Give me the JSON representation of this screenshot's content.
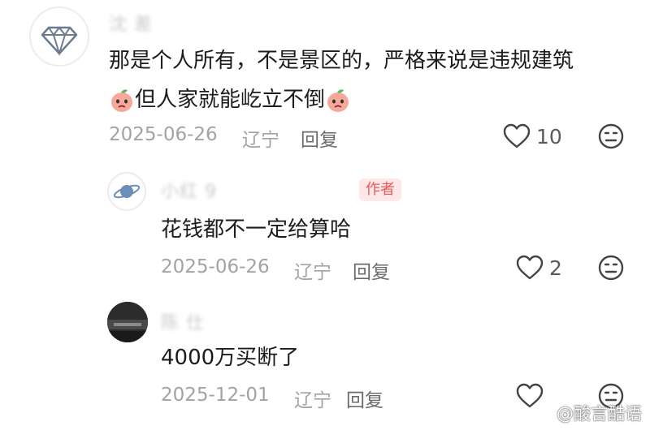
{
  "comments": [
    {
      "username": "沈   差",
      "avatar_icon": "diamond-icon",
      "text_line1": "那是个人所有，不是景区的，严格来说是违规建筑",
      "text_line2": "但人家就能屹立不倒",
      "inline_emoji": "peach-emoji-icon",
      "date": "2025-06-26",
      "location": "辽宁",
      "reply_label": "回复",
      "like_count": "10"
    },
    {
      "username": "小红      9",
      "avatar_icon": "planet-icon",
      "author_badge": "作者",
      "text": "花钱都不一定给算哈",
      "date": "2025-06-26",
      "location": "辽宁",
      "reply_label": "回复",
      "like_count": "2"
    },
    {
      "username": "陈      仕",
      "avatar_icon": "photo-avatar",
      "text": "4000万买断了",
      "date": "2025-12-01",
      "location": "辽宁",
      "reply_label": "回复",
      "like_count": ""
    }
  ],
  "watermark": "@酸言酷语",
  "colors": {
    "badge_bg": "#fde7e7",
    "badge_text": "#e85a5a",
    "meta": "#a3a3a3"
  }
}
